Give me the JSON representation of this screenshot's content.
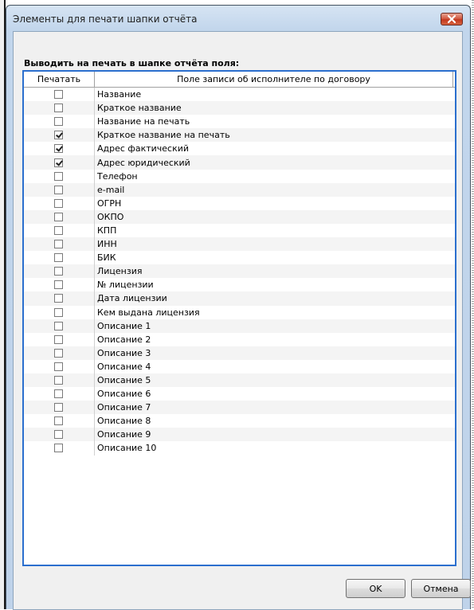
{
  "window": {
    "title": "Элементы для печати шапки отчёта"
  },
  "section": {
    "label": "Выводить на печать в шапке отчёта поля:"
  },
  "grid": {
    "columns": {
      "print": "Печатать",
      "field": "Поле записи об исполнителе по договору"
    },
    "rows": [
      {
        "label": "Название",
        "checked": false
      },
      {
        "label": "Краткое название",
        "checked": false
      },
      {
        "label": "Название на печать",
        "checked": false
      },
      {
        "label": "Краткое название на печать",
        "checked": true
      },
      {
        "label": "Адрес фактический",
        "checked": true
      },
      {
        "label": "Адрес юридический",
        "checked": true
      },
      {
        "label": "Телефон",
        "checked": false
      },
      {
        "label": "e-mail",
        "checked": false
      },
      {
        "label": "ОГРН",
        "checked": false
      },
      {
        "label": "ОКПО",
        "checked": false
      },
      {
        "label": "КПП",
        "checked": false
      },
      {
        "label": "ИНН",
        "checked": false
      },
      {
        "label": "БИК",
        "checked": false
      },
      {
        "label": "Лицензия",
        "checked": false
      },
      {
        "label": "№ лицензии",
        "checked": false
      },
      {
        "label": "Дата лицензии",
        "checked": false
      },
      {
        "label": "Кем выдана лицензия",
        "checked": false
      },
      {
        "label": "Описание 1",
        "checked": false
      },
      {
        "label": "Описание 2",
        "checked": false
      },
      {
        "label": "Описание 3",
        "checked": false
      },
      {
        "label": "Описание 4",
        "checked": false
      },
      {
        "label": "Описание 5",
        "checked": false
      },
      {
        "label": "Описание 6",
        "checked": false
      },
      {
        "label": "Описание 7",
        "checked": false
      },
      {
        "label": "Описание 8",
        "checked": false
      },
      {
        "label": "Описание 9",
        "checked": false
      },
      {
        "label": "Описание 10",
        "checked": false
      }
    ]
  },
  "buttons": {
    "ok": "OK",
    "cancel": "Отмена"
  },
  "icons": {
    "close": "close-icon",
    "checkbox": "checkbox-icon"
  },
  "colors": {
    "accent_border": "#2b6fce",
    "close_button": "#c2381f"
  }
}
